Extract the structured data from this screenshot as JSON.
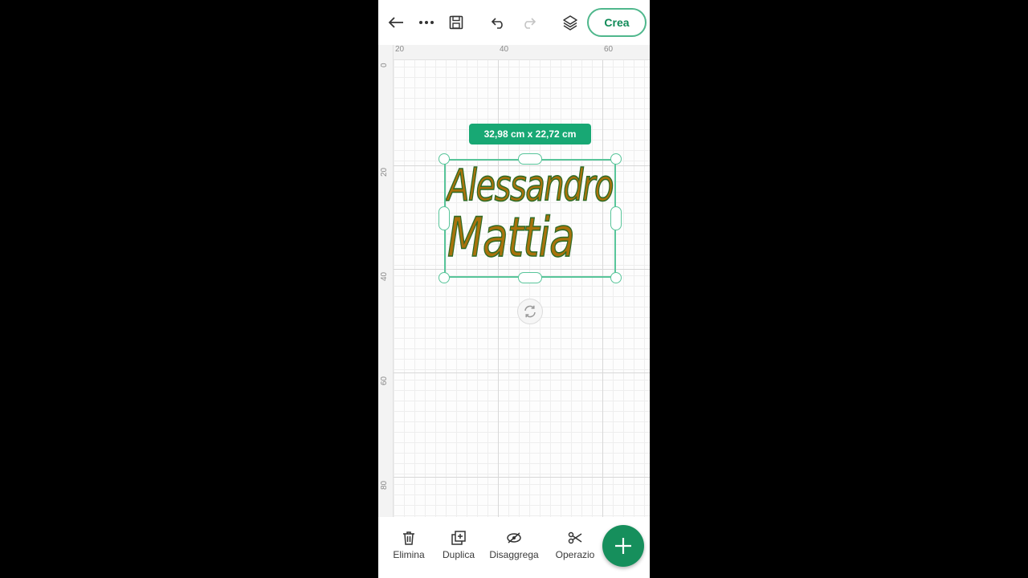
{
  "toolbar": {
    "create_label": "Crea",
    "icons": [
      "back-arrow-icon",
      "more-icon",
      "save-icon",
      "undo-icon",
      "redo-icon",
      "layers-icon"
    ]
  },
  "ruler": {
    "top_labels": [
      "20",
      "40",
      "60"
    ],
    "left_labels": [
      "0",
      "20",
      "40",
      "60",
      "80"
    ]
  },
  "selection": {
    "size_label": "32,98 cm x 22,72 cm",
    "text_line1": "Alessandro",
    "text_line2": "Mattia"
  },
  "bottom_bar": {
    "items": [
      {
        "label": "Elimina",
        "icon": "trash-icon"
      },
      {
        "label": "Duplica",
        "icon": "duplicate-icon"
      },
      {
        "label": "Disaggrega",
        "icon": "ungroup-icon"
      },
      {
        "label": "Operazio",
        "icon": "scissors-icon"
      }
    ],
    "fab_icon": "plus-icon"
  },
  "colors": {
    "accent": "#18a874",
    "fab": "#168f5c",
    "text_fill": "#a8720c",
    "text_outline": "#2e6a24"
  }
}
